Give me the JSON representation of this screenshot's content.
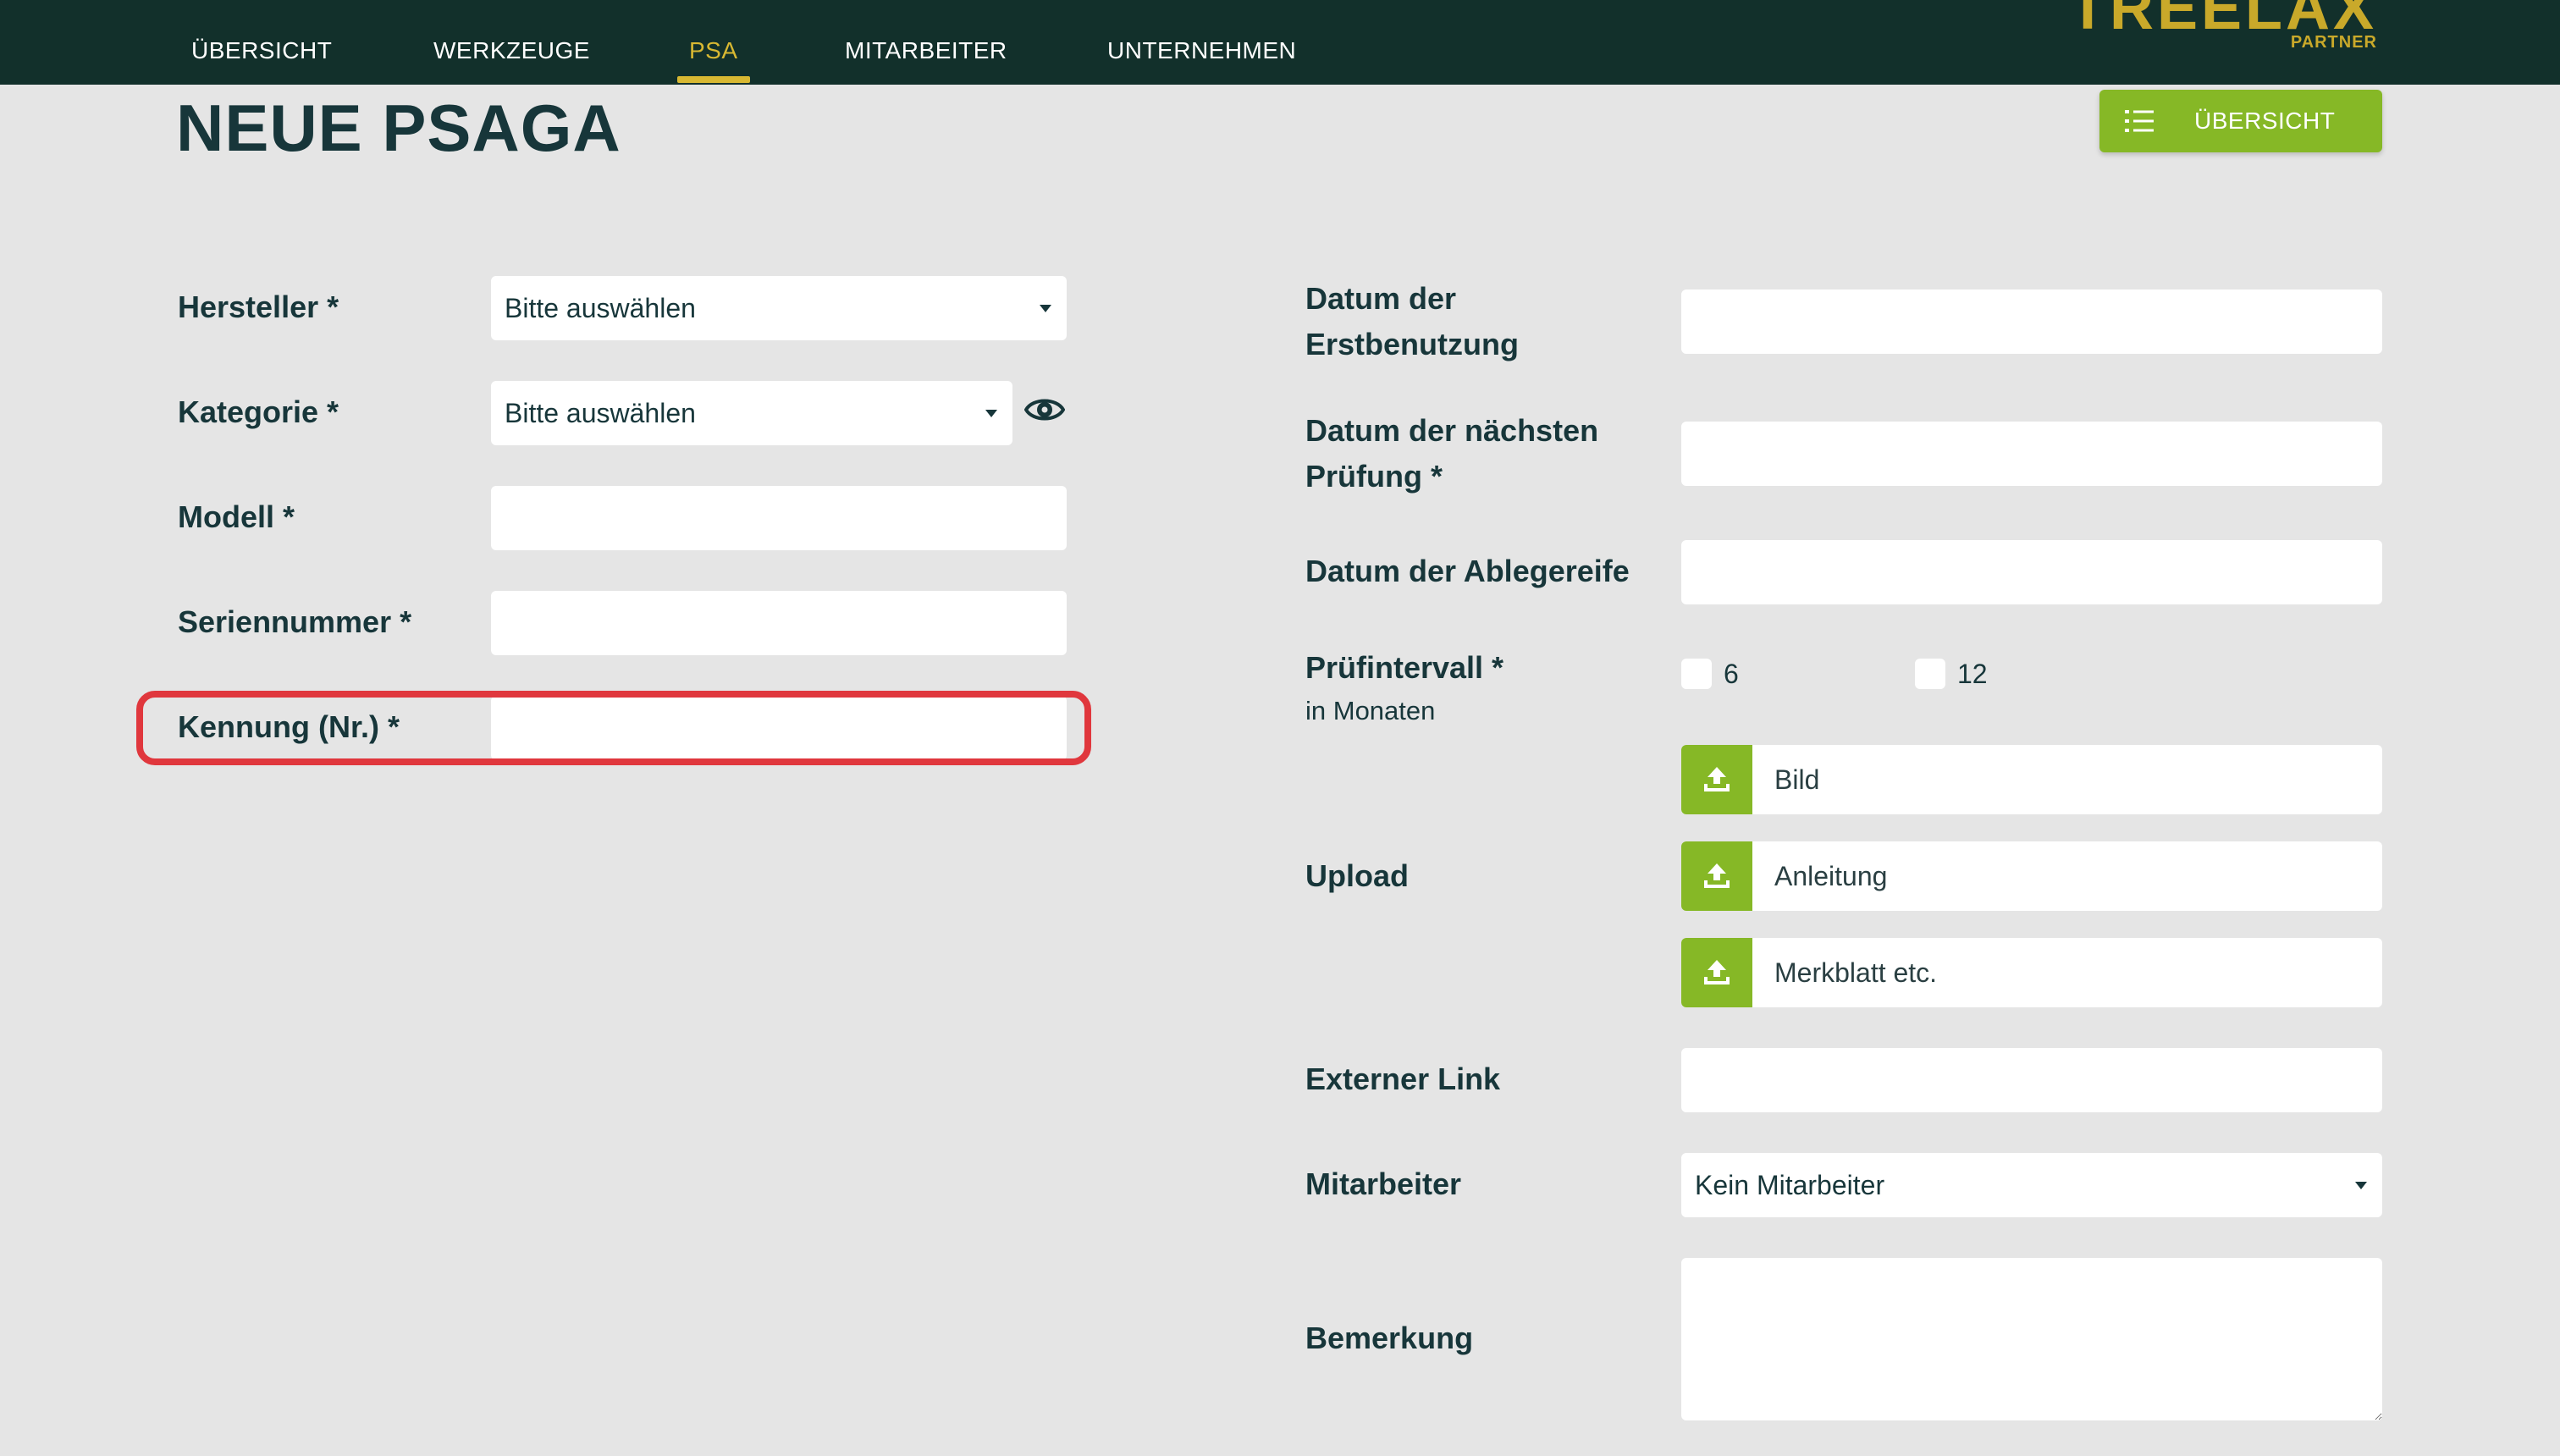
{
  "nav": {
    "items": [
      "ÜBERSICHT",
      "WERKZEUGE",
      "PSA",
      "MITARBEITER",
      "UNTERNEHMEN"
    ],
    "active": "PSA"
  },
  "logo": {
    "word": "TREELAX",
    "sub": "PARTNER"
  },
  "page": {
    "title": "NEUE PSAGA"
  },
  "overview_button": {
    "label": "ÜBERSICHT",
    "icon": "list-icon"
  },
  "colors": {
    "nav_bg": "#12302b",
    "accent_gold": "#d8b832",
    "accent_green": "#86b826",
    "highlight_red": "#e0373d",
    "page_bg": "#e5e5e5"
  },
  "left_form": {
    "hersteller": {
      "label": "Hersteller *",
      "value": "Bitte auswählen"
    },
    "kategorie": {
      "label": "Kategorie *",
      "value": "Bitte auswählen",
      "icon": "eye-icon"
    },
    "modell": {
      "label": "Modell *",
      "value": ""
    },
    "seriennummer": {
      "label": "Seriennummer *",
      "value": ""
    },
    "kennung": {
      "label": "Kennung (Nr.) *",
      "value": ""
    }
  },
  "right_form": {
    "erstbenutzung": {
      "label_line1": "Datum der",
      "label_line2": "Erstbenutzung",
      "value": ""
    },
    "naechste_pruefung": {
      "label_line1": "Datum der nächsten",
      "label_line2": "Prüfung *",
      "value": ""
    },
    "ablegereife": {
      "label": "Datum der Ablegereife",
      "value": ""
    },
    "pruefintervall": {
      "label": "Prüfintervall *",
      "sublabel": "in Monaten",
      "options": [
        "6",
        "12"
      ]
    },
    "upload": {
      "label": "Upload",
      "items": [
        "Bild",
        "Anleitung",
        "Merkblatt etc."
      ],
      "icon": "upload-icon"
    },
    "externer_link": {
      "label": "Externer Link",
      "value": ""
    },
    "mitarbeiter": {
      "label": "Mitarbeiter",
      "value": "Kein Mitarbeiter"
    },
    "bemerkung": {
      "label": "Bemerkung",
      "value": ""
    }
  }
}
